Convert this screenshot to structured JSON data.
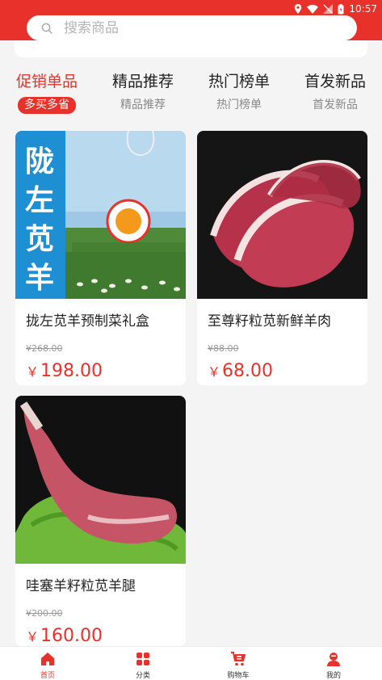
{
  "status_bar": {
    "time": "10:57"
  },
  "search": {
    "placeholder": "搜索商品"
  },
  "tabs": [
    {
      "title": "促销单品",
      "subtitle": "多买多省",
      "active": true
    },
    {
      "title": "精品推荐",
      "subtitle": "精品推荐",
      "active": false
    },
    {
      "title": "热门榜单",
      "subtitle": "热门榜单",
      "active": false
    },
    {
      "title": "首发新品",
      "subtitle": "首发新品",
      "active": false
    }
  ],
  "products": [
    {
      "name": "拢左苋羊预制菜礼盒",
      "old_price": "¥268.00",
      "currency": "￥",
      "price": "198.00"
    },
    {
      "name": "至尊籽粒苋新鲜羊肉",
      "old_price": "¥88.00",
      "currency": "￥",
      "price": "68.00"
    },
    {
      "name": "哇塞羊籽粒苋羊腿",
      "old_price": "¥200.00",
      "currency": "￥",
      "price": "160.00"
    }
  ],
  "bottom_nav": [
    {
      "label": "首页",
      "icon": "home-icon",
      "active": true
    },
    {
      "label": "分类",
      "icon": "grid-icon",
      "active": false
    },
    {
      "label": "购物车",
      "icon": "cart-icon",
      "active": false
    },
    {
      "label": "我的",
      "icon": "user-icon",
      "active": false
    }
  ],
  "colors": {
    "brand": "#e8312a"
  }
}
